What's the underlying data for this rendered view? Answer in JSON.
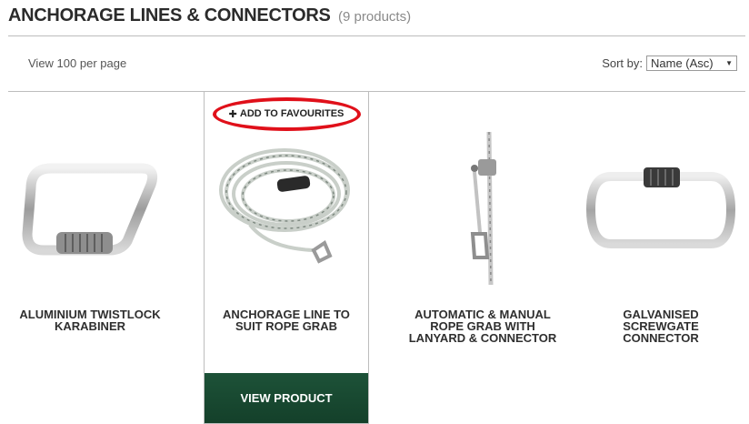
{
  "header": {
    "title": "ANCHORAGE LINES & CONNECTORS",
    "count": "(9 products)"
  },
  "toolbar": {
    "per_page": "View 100 per page",
    "sort_label": "Sort by:",
    "sort_value": "Name (Asc)"
  },
  "products": [
    {
      "name": "ALUMINIUM TWISTLOCK KARABINER",
      "image": "karabiner-image"
    },
    {
      "name": "ANCHORAGE LINE TO SUIT ROPE GRAB",
      "image": "coiled-rope-image",
      "favourite_label": "ADD TO FAVOURITES",
      "view_label": "VIEW PRODUCT"
    },
    {
      "name": "AUTOMATIC & MANUAL ROPE GRAB WITH LANYARD & CONNECTOR",
      "image": "rope-grab-image"
    },
    {
      "name": "GALVANISED SCREWGATE CONNECTOR",
      "image": "screwgate-image"
    }
  ],
  "colors": {
    "accent_green": "#1d5238",
    "highlight_red": "#e0101a"
  }
}
